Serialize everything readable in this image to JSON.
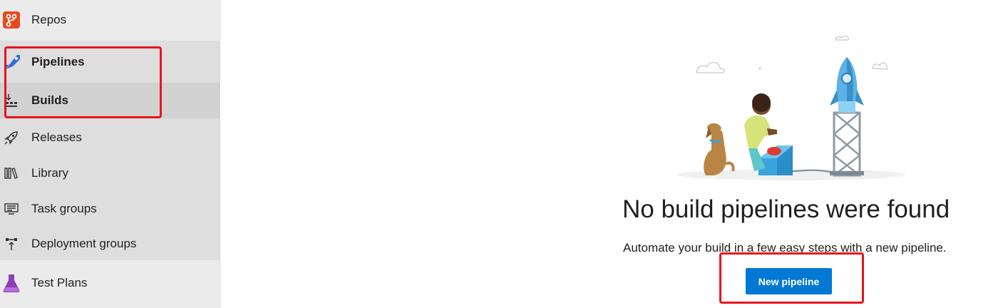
{
  "sidebar": {
    "repos": {
      "label": "Repos",
      "icon": "repos-icon"
    },
    "pipelines": {
      "label": "Pipelines",
      "icon": "pipelines-icon"
    },
    "builds": {
      "label": "Builds",
      "icon": "builds-icon"
    },
    "releases": {
      "label": "Releases",
      "icon": "rocket-icon"
    },
    "library": {
      "label": "Library",
      "icon": "library-icon"
    },
    "task_groups": {
      "label": "Task groups",
      "icon": "task-groups-icon"
    },
    "deployment_groups": {
      "label": "Deployment groups",
      "icon": "deployment-groups-icon"
    },
    "test_plans": {
      "label": "Test Plans",
      "icon": "flask-icon"
    }
  },
  "empty_state": {
    "title": "No build pipelines were found",
    "description": "Automate your build in a few easy steps with a new pipeline.",
    "button_label": "New pipeline"
  },
  "colors": {
    "accent": "#0078d4",
    "highlight_box": "#e8141c",
    "sidebar_bg": "#ebebeb",
    "selected_bg": "#d2d2d2"
  }
}
